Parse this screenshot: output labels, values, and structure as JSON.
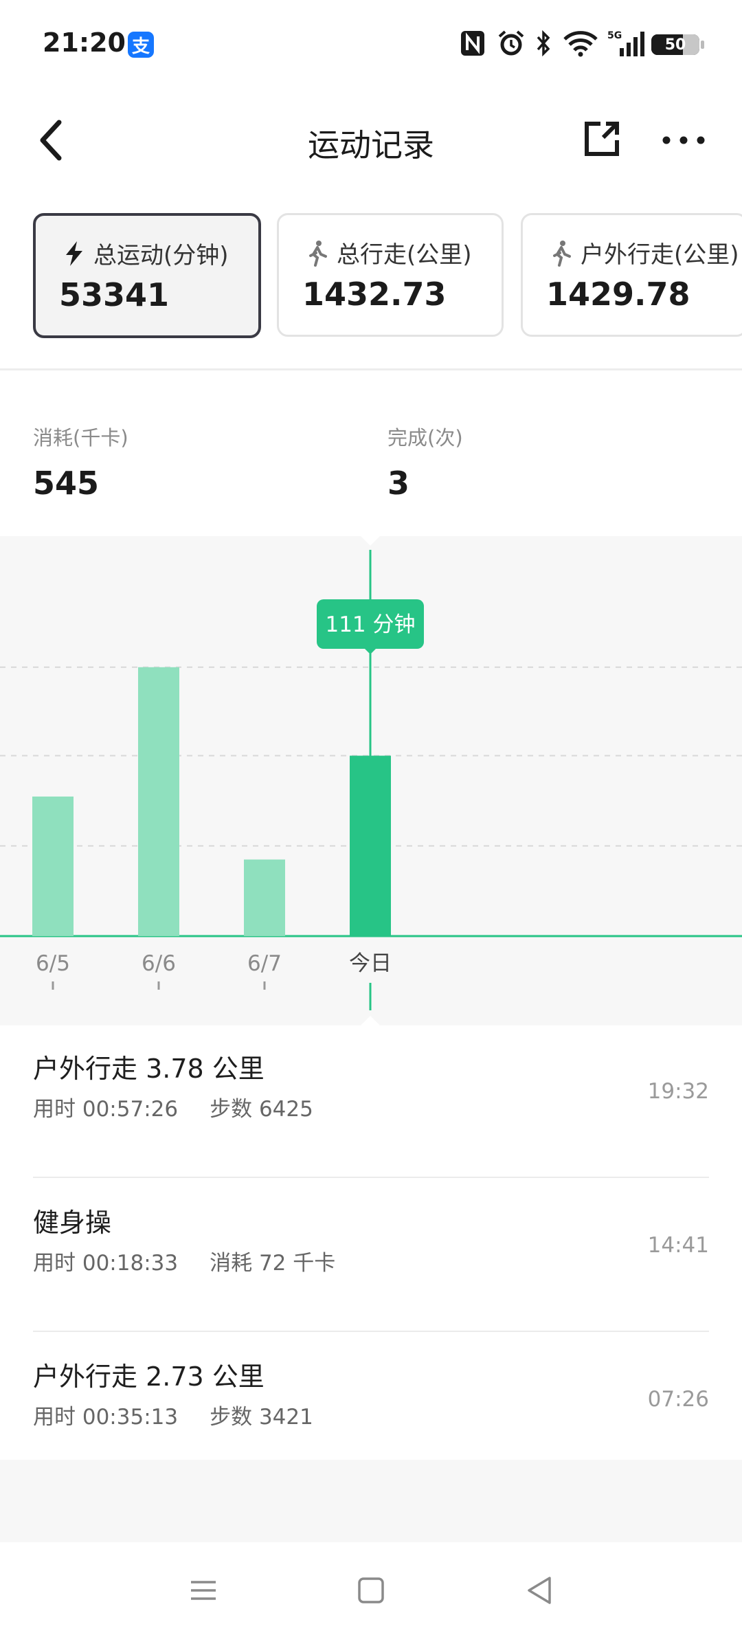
{
  "status_bar": {
    "time": "21:20",
    "app_badge": "支",
    "battery": "50",
    "icons": [
      "nfc-icon",
      "alarm-icon",
      "bluetooth-icon",
      "wifi-icon",
      "5g-signal-icon",
      "battery-icon"
    ]
  },
  "header": {
    "title": "运动记录",
    "back_icon": "chevron-left-icon",
    "share_icon": "share-external-icon",
    "more_icon": "more-horizontal-icon"
  },
  "cards": [
    {
      "label": "总运动(分钟)",
      "value": "53341",
      "icon": "lightning-icon",
      "selected": true
    },
    {
      "label": "总行走(公里)",
      "value": "1432.73",
      "icon": "walking-icon",
      "selected": false
    },
    {
      "label": "户外行走(公里)",
      "value": "1429.78",
      "icon": "walking-icon",
      "selected": false
    }
  ],
  "stats": [
    {
      "label": "消耗(千卡)",
      "value": "545"
    },
    {
      "label": "完成(次)",
      "value": "3"
    }
  ],
  "chart_data": {
    "type": "bar",
    "categories": [
      "6/5",
      "6/6",
      "6/7",
      "今日"
    ],
    "values": [
      82,
      158,
      45,
      106
    ],
    "unit": "分钟",
    "ylim": [
      0,
      210
    ],
    "gridlines": [
      53,
      106,
      158
    ],
    "selected_index": 3,
    "tooltip": "111 分钟",
    "colors": {
      "bar": "#8fe0be",
      "bar_selected": "#27c486",
      "axis": "#27c486",
      "grid": "#d8d8d8"
    }
  },
  "records": [
    {
      "title": "户外行走 3.78 公里",
      "duration": "用时 00:57:26",
      "extra": "步数 6425",
      "time": "19:32"
    },
    {
      "title": "健身操",
      "duration": "用时 00:18:33",
      "extra": "消耗 72 千卡",
      "time": "14:41"
    },
    {
      "title": "户外行走 2.73 公里",
      "duration": "用时 00:35:13",
      "extra": "步数 3421",
      "time": "07:26"
    }
  ],
  "nav_bar": {
    "icons": [
      "menu-icon",
      "home-square-icon",
      "back-triangle-icon"
    ]
  }
}
